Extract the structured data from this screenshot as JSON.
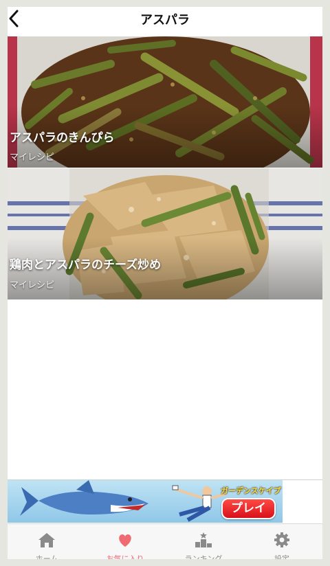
{
  "header": {
    "title": "アスパラ"
  },
  "recipes": [
    {
      "name": "アスパラのきんぴら",
      "subtitle": "マイレシピ"
    },
    {
      "name": "鶏肉とアスパラのチーズ炒め",
      "subtitle": "マイレシピ"
    }
  ],
  "ad": {
    "game_title": "ガーデンスケイプ",
    "play_label": "プレイ"
  },
  "tabs": [
    {
      "label": "ホーム",
      "icon": "home-icon"
    },
    {
      "label": "お気に入り",
      "icon": "heart-icon",
      "active": true
    },
    {
      "label": "ランキング",
      "icon": "ranking-icon"
    },
    {
      "label": "設定",
      "icon": "gear-icon"
    }
  ],
  "colors": {
    "active_tab": "#f06a74",
    "inactive_tab": "#8a8a8a"
  }
}
